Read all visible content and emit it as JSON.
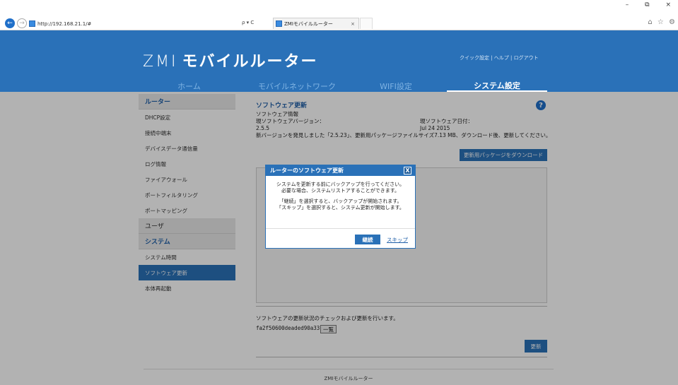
{
  "browser": {
    "url": "http://192.168.21.1/#",
    "address_tools": "ρ ▾ C",
    "tab_title": "ZMIモバイルルーター",
    "tab_close": "×",
    "window_controls": "– ⧉ ×",
    "toolbar_icons": "⌂ ☆ ⚙"
  },
  "header": {
    "brand_logo": "ZMI",
    "brand_text": "モバイルルーター",
    "top_links": "クイック設定 | ヘルプ | ログアウト",
    "nav": [
      {
        "label": "ホーム"
      },
      {
        "label": "モバイルネットワーク"
      },
      {
        "label": "WIFI設定"
      },
      {
        "label": "システム設定"
      }
    ]
  },
  "sidebar": {
    "group_router": "ルーター",
    "router_items": [
      "DHCP設定",
      "接続中端末",
      "デバイスデータ通信量",
      "ログ情報",
      "ファイアウォール",
      "ポートフィルタリング",
      "ポートマッピング"
    ],
    "group_user": "ユーザ",
    "group_system": "システム",
    "system_items": [
      "システム時間",
      "ソフトウェア更新",
      "本体再起動"
    ]
  },
  "main": {
    "title": "ソフトウェア更新",
    "help_icon": "?",
    "software_info": "ソフトウェア情報",
    "current_version_label": "現ソフトウェアバージョン：",
    "current_version": "2.5.5",
    "current_date_label": "現ソフトウェア日付：",
    "current_date": "Jul 24 2015",
    "new_version_msg": "新バージョンを発見しました「2.5.23」、更新用パッケージファイルサイズ7.13 MB、ダウンロード後、更新してください。",
    "download_button": "更新用パッケージをダウンロード",
    "check_desc": "ソフトウェアの更新状況のチェックおよび更新を行います。",
    "hash_value": "fa2f50600deaded90a33c33",
    "list_button": "一覧",
    "update_button": "更新"
  },
  "footer": {
    "text": "ZMIモバイルルーター"
  },
  "modal": {
    "title": "ルーターのソフトウェア更新",
    "close_icon": "X",
    "para1_line1": "システムを更新する前にバックアップを行ってください。",
    "para1_line2": "必要な場合、システムリストアすることができます。",
    "para2_line1": "「継続」を選択すると、バックアップが開始されます。",
    "para2_line2": "「スキップ」を選択すると、システム更新が開始します。",
    "continue_button": "継続",
    "skip_link": "スキップ"
  },
  "colors": {
    "brand_blue": "#2a71b8",
    "sidebar_group": "#e9e9e9"
  }
}
